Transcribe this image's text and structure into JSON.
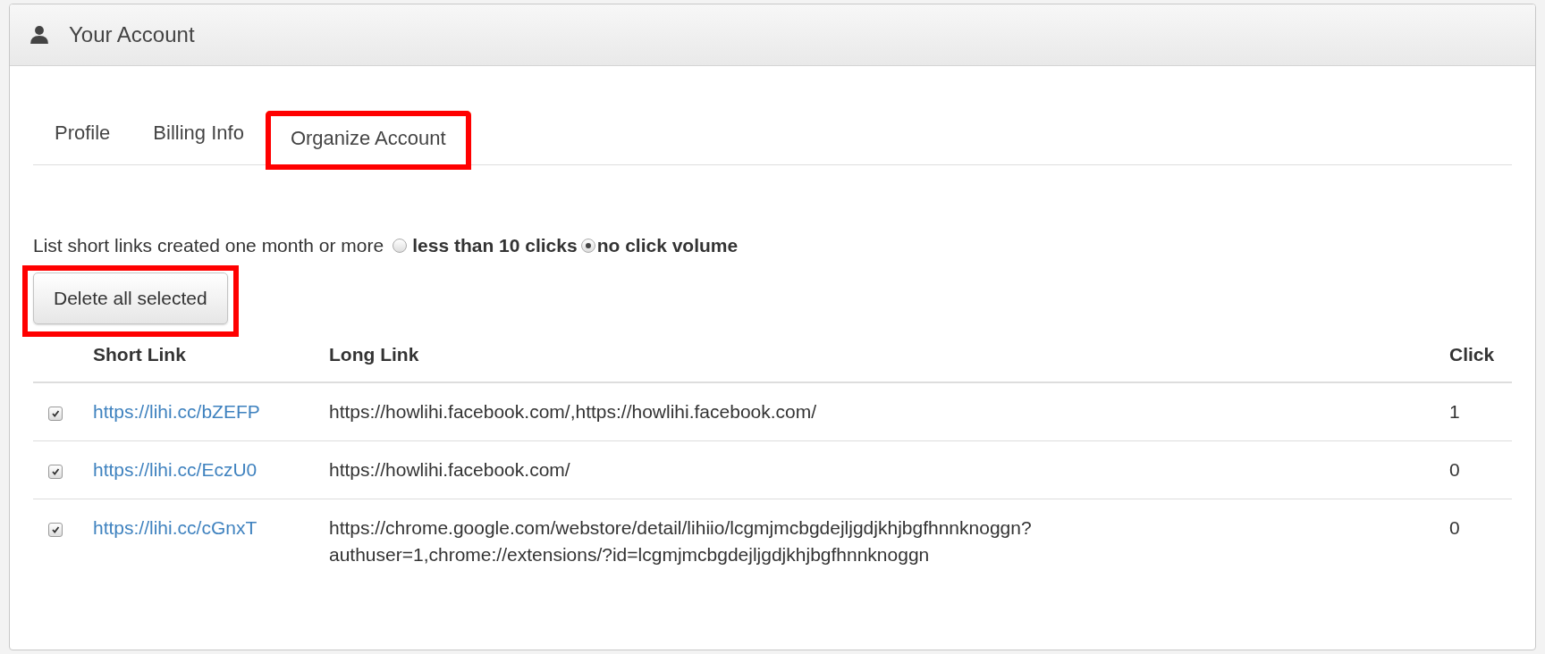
{
  "panel": {
    "title": "Your Account"
  },
  "tabs": [
    {
      "label": "Profile",
      "selected": false,
      "highlighted": false
    },
    {
      "label": "Billing Info",
      "selected": false,
      "highlighted": false
    },
    {
      "label": "Organize Account",
      "selected": true,
      "highlighted": true
    }
  ],
  "filter": {
    "label": "List short links created one month or more",
    "options": [
      {
        "label": "less than 10 clicks",
        "selected": false
      },
      {
        "label": "no click volume",
        "selected": true
      }
    ]
  },
  "delete_button": {
    "label": "Delete all selected",
    "highlighted": true
  },
  "table": {
    "columns": [
      "Short Link",
      "Long Link",
      "Click"
    ],
    "rows": [
      {
        "checked": true,
        "short_link": "https://lihi.cc/bZEFP",
        "long_link": "https://howlihi.facebook.com/,https://howlihi.facebook.com/",
        "click": "1"
      },
      {
        "checked": true,
        "short_link": "https://lihi.cc/EczU0",
        "long_link": "https://howlihi.facebook.com/",
        "click": "0"
      },
      {
        "checked": true,
        "short_link": "https://lihi.cc/cGnxT",
        "long_link": "https://chrome.google.com/webstore/detail/lihiio/lcgmjmcbgdejljgdjkhjbgfhnnknoggn?authuser=1,chrome://extensions/?id=lcgmjmcbgdejljgdjkhjbgfhnnknoggn",
        "click": "0"
      }
    ]
  }
}
